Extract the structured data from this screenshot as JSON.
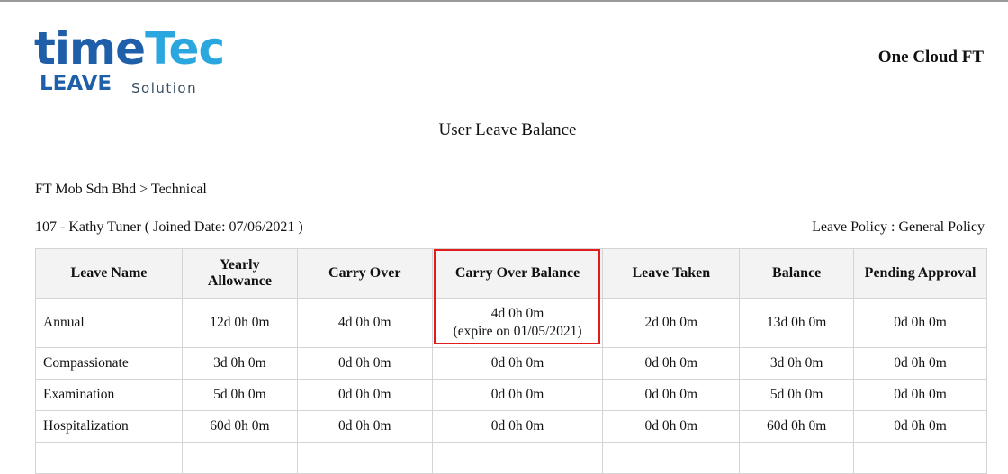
{
  "logo": {
    "time": "time",
    "tec": "Tec",
    "leave": "LEAVE",
    "solution": "Solution"
  },
  "header": {
    "company": "One Cloud FT"
  },
  "report": {
    "title": "User Leave Balance",
    "department": "FT Mob Sdn Bhd > Technical",
    "employee": "107 - Kathy Tuner ( Joined Date: 07/06/2021 )",
    "policy": "Leave Policy : General Policy"
  },
  "table": {
    "columns": [
      "Leave Name",
      "Yearly Allowance",
      "Carry Over",
      "Carry Over Balance",
      "Leave Taken",
      "Balance",
      "Pending Approval"
    ],
    "rows": [
      {
        "name": "Annual",
        "yearly": "12d 0h 0m",
        "carry": "4d 0h 0m",
        "carry_balance": "4d 0h 0m",
        "carry_expiry": "(expire on 01/05/2021)",
        "taken": "2d 0h 0m",
        "balance": "13d 0h 0m",
        "pending": "0d 0h 0m"
      },
      {
        "name": "Compassionate",
        "yearly": "3d 0h 0m",
        "carry": "0d 0h 0m",
        "carry_balance": "0d 0h 0m",
        "taken": "0d 0h 0m",
        "balance": "3d 0h 0m",
        "pending": "0d 0h 0m"
      },
      {
        "name": "Examination",
        "yearly": "5d 0h 0m",
        "carry": "0d 0h 0m",
        "carry_balance": "0d 0h 0m",
        "taken": "0d 0h 0m",
        "balance": "5d 0h 0m",
        "pending": "0d 0h 0m"
      },
      {
        "name": "Hospitalization",
        "yearly": "60d 0h 0m",
        "carry": "0d 0h 0m",
        "carry_balance": "0d 0h 0m",
        "taken": "0d 0h 0m",
        "balance": "60d 0h 0m",
        "pending": "0d 0h 0m"
      }
    ]
  },
  "colors": {
    "highlight": "#e01c1c",
    "logo_dark": "#1f5ea8",
    "logo_light": "#2aa7df",
    "header_bg": "#f3f3f3"
  }
}
